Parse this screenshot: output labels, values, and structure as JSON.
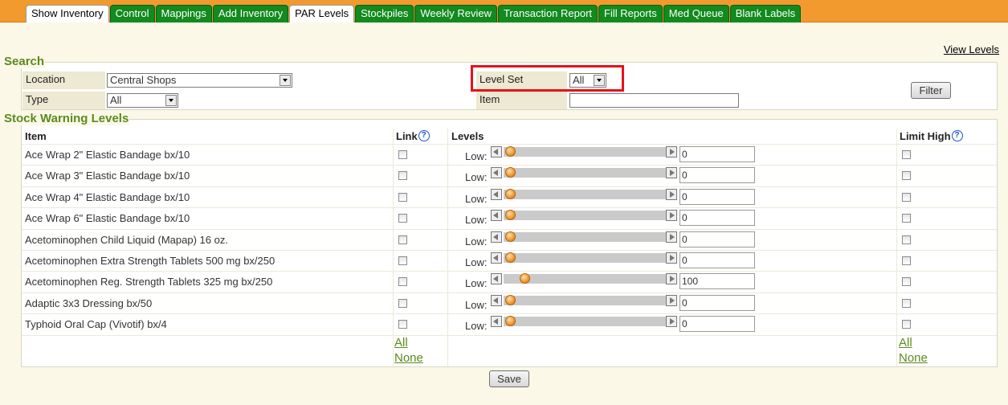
{
  "tabs": [
    {
      "label": "Show Inventory",
      "style": "white"
    },
    {
      "label": "Control",
      "style": "green"
    },
    {
      "label": "Mappings",
      "style": "green"
    },
    {
      "label": "Add Inventory",
      "style": "green"
    },
    {
      "label": "PAR Levels",
      "style": "white"
    },
    {
      "label": "Stockpiles",
      "style": "green"
    },
    {
      "label": "Weekly Review",
      "style": "green"
    },
    {
      "label": "Transaction Report",
      "style": "green"
    },
    {
      "label": "Fill Reports",
      "style": "green"
    },
    {
      "label": "Med Queue",
      "style": "green"
    },
    {
      "label": "Blank Labels",
      "style": "green"
    }
  ],
  "view_levels_link": "View Levels",
  "search": {
    "title": "Search",
    "location_label": "Location",
    "location_value": "Central Shops",
    "type_label": "Type",
    "type_value": "All",
    "level_set_label": "Level Set",
    "level_set_value": "All",
    "item_label": "Item",
    "item_value": "",
    "filter_button": "Filter"
  },
  "warning": {
    "title": "Stock Warning Levels",
    "col_item": "Item",
    "col_link": "Link",
    "col_levels": "Levels",
    "col_limit_high": "Limit High",
    "help_glyph": "?",
    "low_label": "Low:",
    "rows": [
      {
        "item": "Ace Wrap 2\" Elastic Bandage bx/10",
        "low": "0",
        "link": false,
        "limit_high": false
      },
      {
        "item": "Ace Wrap 3\" Elastic Bandage bx/10",
        "low": "0",
        "link": false,
        "limit_high": false
      },
      {
        "item": "Ace Wrap 4\" Elastic Bandage bx/10",
        "low": "0",
        "link": false,
        "limit_high": false
      },
      {
        "item": "Ace Wrap 6\" Elastic Bandage bx/10",
        "low": "0",
        "link": false,
        "limit_high": false
      },
      {
        "item": "Acetominophen Child Liquid (Mapap) 16 oz.",
        "low": "0",
        "link": false,
        "limit_high": false
      },
      {
        "item": "Acetominophen Extra Strength Tablets 500 mg bx/250",
        "low": "0",
        "link": false,
        "limit_high": false
      },
      {
        "item": "Acetominophen Reg. Strength Tablets 325 mg bx/250",
        "low": "100",
        "link": false,
        "limit_high": false
      },
      {
        "item": "Adaptic 3x3 Dressing bx/50",
        "low": "0",
        "link": false,
        "limit_high": false
      },
      {
        "item": "Typhoid Oral Cap (Vivotif) bx/4",
        "low": "0",
        "link": false,
        "limit_high": false
      }
    ],
    "all_link": "All",
    "none_link": "None"
  },
  "save_button": "Save",
  "colors": {
    "accent_orange": "#f29a2e",
    "tab_green": "#128a1d",
    "section_green": "#5b8a1c",
    "highlight_red": "#e8101a"
  },
  "icons": {
    "help": "help-icon",
    "dropdown": "chevron-down-icon",
    "slider_left": "arrow-left-icon",
    "slider_right": "arrow-right-icon"
  }
}
